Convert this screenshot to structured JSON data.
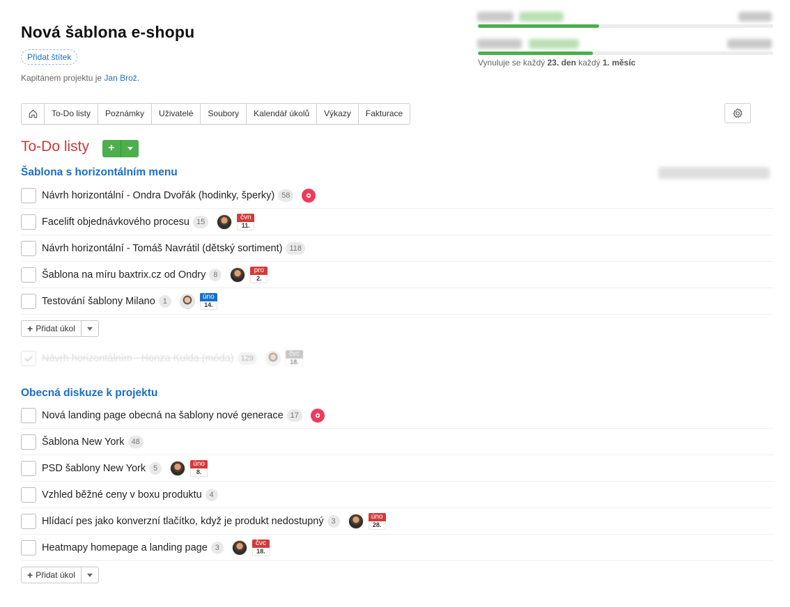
{
  "header": {
    "title": "Nová šablona e-shopu",
    "tag_button": "Přidat štítek",
    "captain_prefix": "Kapitánem projektu je ",
    "captain_name": "Jan Brož",
    "captain_suffix": "."
  },
  "progress": {
    "bars": [
      {
        "fill_fraction": 0.41
      },
      {
        "fill_fraction": 0.39
      }
    ],
    "reset_prefix": "Vynuluje se každý ",
    "reset_day": "23. den",
    "reset_mid": " každý ",
    "reset_period": "1. měsíc"
  },
  "nav": {
    "home_icon": "home-icon",
    "items": [
      "To-Do listy",
      "Poznámky",
      "Uživatelé",
      "Soubory",
      "Kalendář úkolů",
      "Výkazy",
      "Fakturace"
    ],
    "settings_icon": "gear-icon"
  },
  "section": {
    "title": "To-Do listy",
    "add_icon": "+"
  },
  "lists": [
    {
      "title": "Šablona s horizontálním menu",
      "tasks": [
        {
          "name": "Návrh horizontální - Ondra Dvořák (hodinky, šperky)",
          "count": "58",
          "bell": true
        },
        {
          "name": "Facelift objednávkového procesu",
          "count": "15",
          "avatar": true,
          "month": "čvn",
          "day": "11.",
          "month_color": "#d33a3a"
        },
        {
          "name": "Návrh horizontální - Tomáš Navrátil (dětský sortiment)",
          "count": "118"
        },
        {
          "name": "Šablona na míru baxtrix.cz od Ondry",
          "count": "8",
          "avatar": true,
          "month": "pro",
          "day": "2.",
          "month_color": "#d33a3a"
        },
        {
          "name": "Testování šablony Milano",
          "count": "1",
          "avatar": true,
          "avatar_light": true,
          "month": "úno",
          "day": "14.",
          "month_color": "#1a6fc4"
        }
      ],
      "add_task": "Přidat úkol",
      "done": {
        "name": "Návrh horizontálním - Honza Kulda (móda)",
        "count": "129",
        "month": "čvc",
        "day": "18."
      }
    },
    {
      "title": "Obecná diskuze k projektu",
      "tasks": [
        {
          "name": "Nová landing page obecná na šablony nové generace",
          "count": "17",
          "bell": true
        },
        {
          "name": "Šablona New York",
          "count": "48"
        },
        {
          "name": "PSD šablony New York",
          "count": "5",
          "avatar": true,
          "month": "úno",
          "day": "8.",
          "month_color": "#d33a3a"
        },
        {
          "name": "Vzhled běžné ceny v boxu produktu",
          "count": "4"
        },
        {
          "name": "Hlídací pes jako konverzní tlačítko, když je produkt nedostupný",
          "count": "3",
          "avatar": true,
          "month": "úno",
          "day": "28.",
          "month_color": "#d33a3a"
        },
        {
          "name": "Heatmapy homepage a landing page",
          "count": "3",
          "avatar": true,
          "month": "čvc",
          "day": "18.",
          "month_color": "#d33a3a"
        }
      ],
      "add_task": "Přidat úkol"
    }
  ]
}
